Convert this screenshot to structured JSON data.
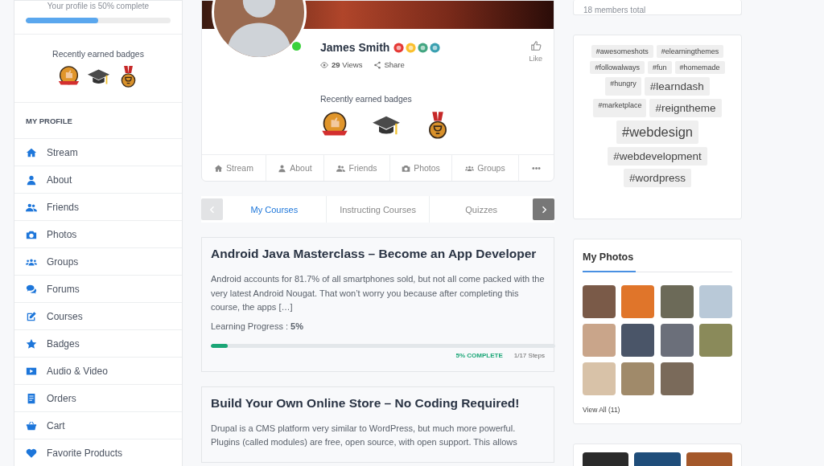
{
  "profile_progress": {
    "text": "Your profile is 50% complete",
    "level": 0.5
  },
  "sidebar_badges": {
    "title": "Recently earned badges"
  },
  "sidebar": {
    "heading": "MY PROFILE",
    "items": [
      {
        "label": "Stream"
      },
      {
        "label": "About"
      },
      {
        "label": "Friends"
      },
      {
        "label": "Photos"
      },
      {
        "label": "Groups"
      },
      {
        "label": "Forums"
      },
      {
        "label": "Courses"
      },
      {
        "label": "Badges"
      },
      {
        "label": "Audio & Video"
      },
      {
        "label": "Orders"
      },
      {
        "label": "Cart"
      },
      {
        "label": "Favorite Products"
      }
    ]
  },
  "profile": {
    "name": "James Smith",
    "online": true,
    "views": "**29** Views",
    "share": "Share",
    "like": "Like",
    "badges_title": "Recently earned badges",
    "tabs": [
      {
        "label": "Stream"
      },
      {
        "label": "About"
      },
      {
        "label": "Friends"
      },
      {
        "label": "Photos"
      },
      {
        "label": "Groups"
      },
      {
        "label": "•••"
      }
    ]
  },
  "course_tabs": {
    "prev_disabled": true,
    "next_disabled": false,
    "tabs": [
      {
        "label": "My Courses",
        "selected": true
      },
      {
        "label": "Instructing Courses",
        "selected": false
      },
      {
        "label": "Quizzes",
        "selected": false
      }
    ]
  },
  "courses": [
    {
      "title": "Android Java Masterclass – Become an App Developer",
      "description": "Android accounts for 81.7% of all smartphones sold, but not all come packed with the very latest Android Nougat. That won’t worry you because after completing this course, the apps […]",
      "progress_label": "Learning Progress : **5%**",
      "level": 0.05,
      "complete": "5% COMPLETE",
      "steps": "1/17 Steps"
    },
    {
      "title": "Build Your Own Online Store – No Coding Required!",
      "description": "Drupal is a CMS platform very similar to WordPress, but much more powerful. Plugins (called modules) are free, open source, with open support. This allows"
    }
  ],
  "members": {
    "text": "18 members total"
  },
  "tags": [
    {
      "label": "#awesomeshots",
      "kind": "small"
    },
    {
      "label": "#elearningthemes",
      "kind": "small"
    },
    {
      "label": "#followalways",
      "kind": "small"
    },
    {
      "label": "#fun",
      "kind": "small"
    },
    {
      "label": "#homemade",
      "kind": "small"
    },
    {
      "label": "#hungry",
      "kind": "small"
    },
    {
      "label": "#learndash",
      "kind": "medium"
    },
    {
      "label": "#marketplace",
      "kind": "small"
    },
    {
      "label": "#reigntheme",
      "kind": "medium"
    },
    {
      "label": "#webdesign",
      "kind": "large"
    },
    {
      "label": "#webdevelopment",
      "kind": "medium"
    },
    {
      "label": "#wordpress",
      "kind": "medium"
    }
  ],
  "photos": {
    "title": "My Photos",
    "view_all": "View All (11)"
  }
}
